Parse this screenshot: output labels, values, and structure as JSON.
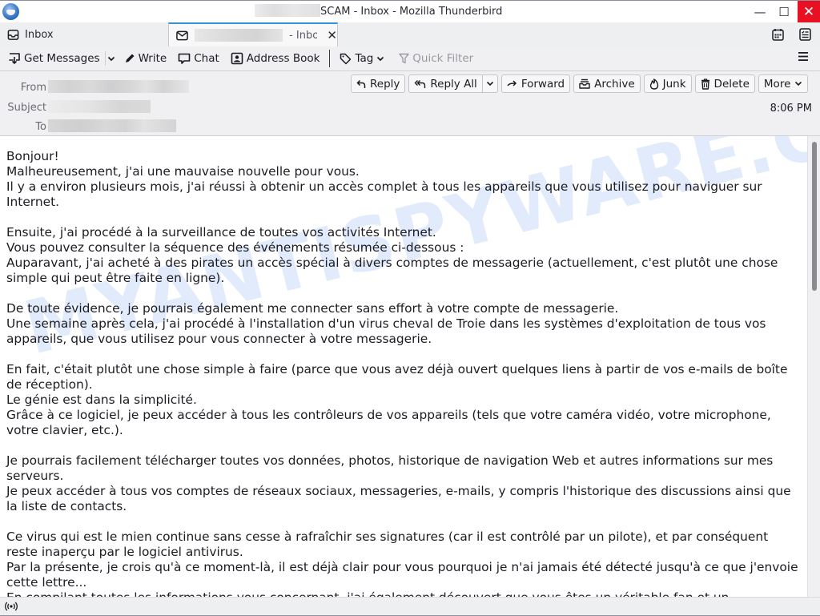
{
  "window": {
    "title_suffix": "SCAM - Inbox - Mozilla Thunderbird",
    "minimize_glyph": "—",
    "maximize_glyph": "☐",
    "close_glyph": "✕"
  },
  "tabs": [
    {
      "label": "Inbox",
      "icon": "inbox-icon",
      "active": false
    },
    {
      "label": "- Inbox",
      "icon": "envelope-icon",
      "active": true,
      "close_glyph": "✕"
    }
  ],
  "toolbar": {
    "get_messages": "Get Messages",
    "write": "Write",
    "chat": "Chat",
    "address_book": "Address Book",
    "tag": "Tag",
    "quick_filter": "Quick Filter",
    "menu_glyph": "☰"
  },
  "header": {
    "from_label": "From",
    "subject_label": "Subject",
    "to_label": "To",
    "time": "8:06 PM",
    "actions": {
      "reply": "Reply",
      "reply_all": "Reply All",
      "forward": "Forward",
      "archive": "Archive",
      "junk": "Junk",
      "delete": "Delete",
      "more": "More"
    }
  },
  "message": {
    "watermark": "MYANTISPYWARE.COM",
    "lines": [
      "Bonjour!",
      "Malheureusement, j'ai une mauvaise nouvelle pour vous.",
      "Il y a environ plusieurs mois, j'ai réussi à obtenir un accès complet à tous les appareils que vous utilisez pour naviguer sur Internet.",
      "",
      "Ensuite, j'ai procédé à la surveillance de toutes vos activités Internet.",
      "Vous pouvez consulter la séquence des événements résumée ci-dessous :",
      "Auparavant, j'ai acheté à des pirates un accès spécial à divers comptes de messagerie (actuellement, c'est plutôt une chose simple qui peut être faite en ligne).",
      "",
      "De toute évidence, je pourrais également me connecter sans effort à votre compte de messagerie.",
      "Une semaine après cela, j'ai procédé à l'installation d'un virus cheval de Troie dans les systèmes d'exploitation de tous vos appareils, que vous utilisez pour vous connecter à votre messagerie.",
      "",
      "En fait, c'était plutôt une chose simple à faire (parce que vous avez déjà ouvert quelques liens à partir de vos e-mails de boîte de réception).",
      "Le génie est dans la simplicité.",
      "Grâce à ce logiciel, je peux accéder à tous les contrôleurs de vos appareils (tels que votre caméra vidéo, votre microphone, votre clavier, etc.).",
      "",
      "Je pourrais facilement télécharger toutes vos données, photos, historique de navigation Web et autres informations sur mes serveurs.",
      "Je peux accéder à tous vos comptes de réseaux sociaux, messageries, e-mails, y compris l'historique des discussions ainsi que la liste de contacts.",
      "",
      "Ce virus qui est le mien continue sans cesse à rafraîchir ses signatures (car il est contrôlé par un pilote), et par conséquent reste inaperçu par le logiciel antivirus.",
      "Par la présente, je crois qu'à ce moment-là, il est déjà clair pour vous pourquoi je n'ai jamais été détecté jusqu'à ce que j'envoie cette lettre...",
      "En compilant toutes les informations vous concernant, j'ai également découvert que vous êtes un véritable fan et un"
    ]
  },
  "colors": {
    "accent_tab": "#3592d8",
    "close_red": "#e81123",
    "watermark": "#78a5eb"
  }
}
